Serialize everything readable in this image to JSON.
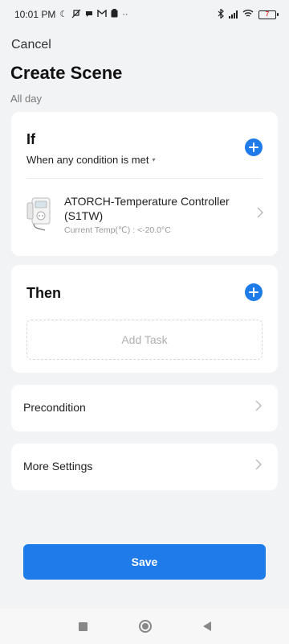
{
  "status_bar": {
    "time": "10:01 PM",
    "battery_level": "7",
    "icons": [
      "moon-icon",
      "mute-icon",
      "chat-icon",
      "mail-icon",
      "clipboard-icon",
      "more-dots-icon",
      "bluetooth-icon",
      "signal-icon",
      "wifi-icon",
      "battery-icon"
    ]
  },
  "header": {
    "cancel_label": "Cancel",
    "title": "Create Scene",
    "subtitle": "All day"
  },
  "if_section": {
    "title": "If",
    "condition_mode": "When any condition is met",
    "conditions": [
      {
        "device_name": "ATORCH-Temperature Controller (S1TW)",
        "detail": "Current Temp(℃) : <-20.0°C"
      }
    ]
  },
  "then_section": {
    "title": "Then",
    "add_task_label": "Add Task"
  },
  "rows": {
    "precondition_label": "Precondition",
    "more_settings_label": "More Settings"
  },
  "footer": {
    "save_label": "Save"
  },
  "colors": {
    "accent": "#1f7bea",
    "background": "#f2f3f5",
    "card": "#ffffff"
  }
}
